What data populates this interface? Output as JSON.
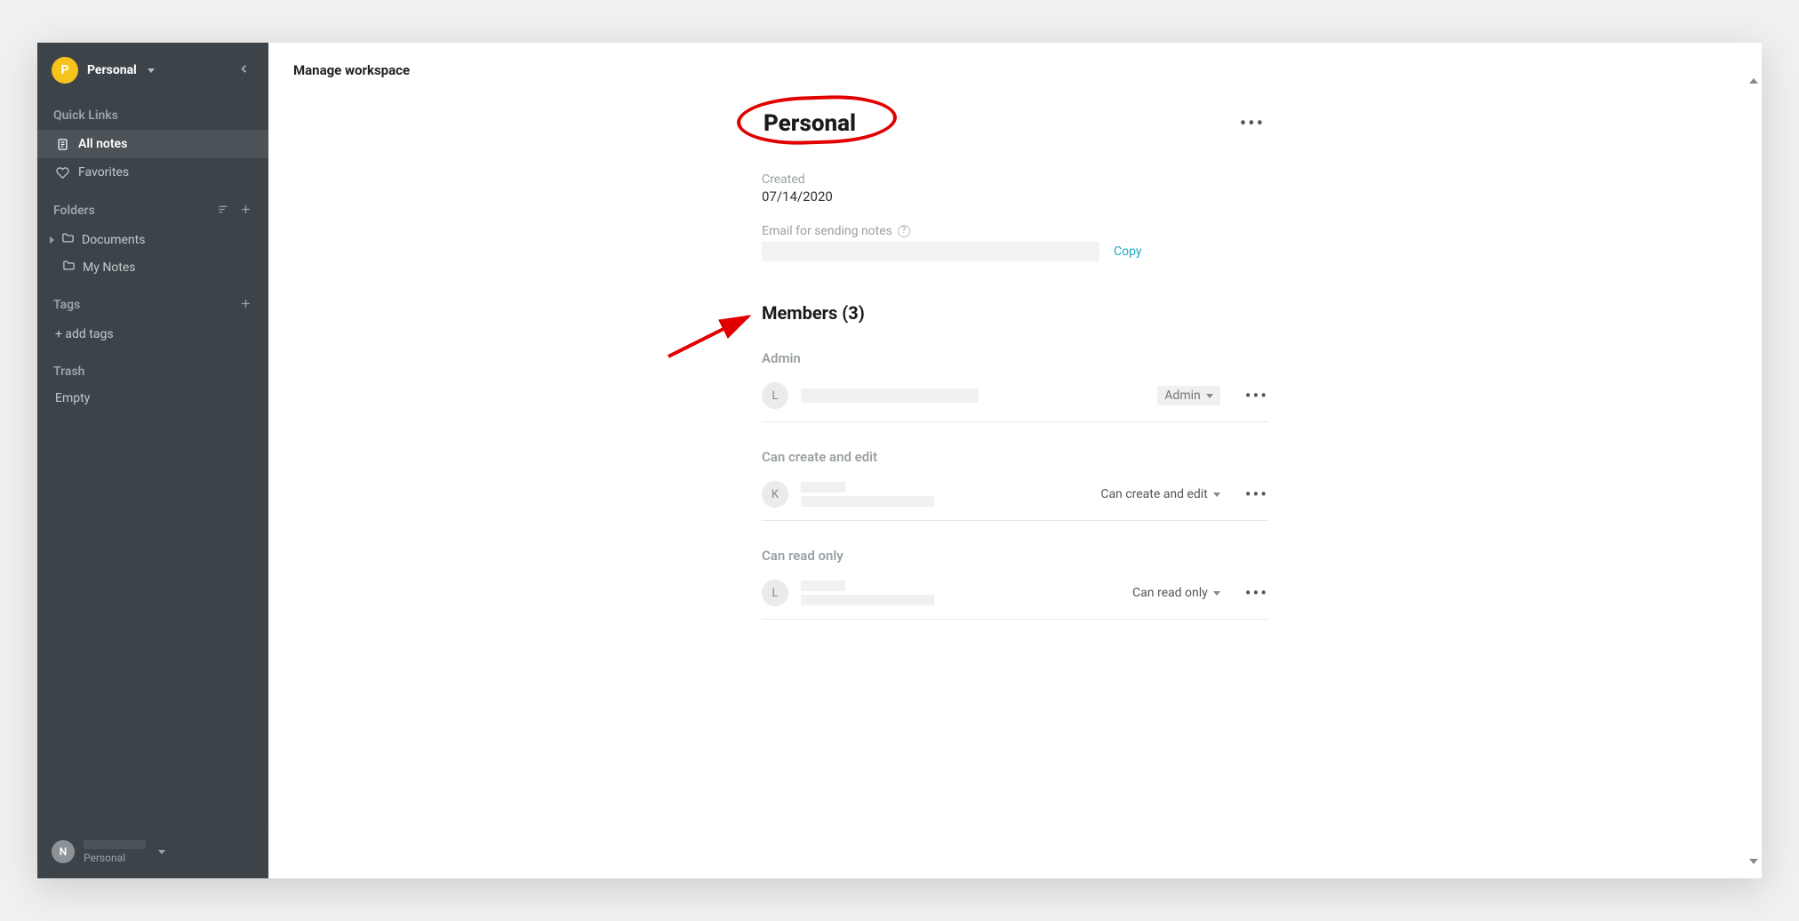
{
  "sidebar": {
    "workspace_avatar_letter": "P",
    "workspace_name": "Personal",
    "quick_links_label": "Quick Links",
    "all_notes": "All notes",
    "favorites": "Favorites",
    "folders_label": "Folders",
    "folders": {
      "documents": "Documents",
      "my_notes": "My Notes"
    },
    "tags_label": "Tags",
    "add_tags": "+ add tags",
    "trash_label": "Trash",
    "trash_empty": "Empty",
    "footer_user_avatar": "N",
    "footer_sub": "Personal"
  },
  "main": {
    "header": "Manage workspace",
    "title": "Personal",
    "created_label": "Created",
    "created_value": "07/14/2020",
    "email_label": "Email for sending notes",
    "copy": "Copy",
    "members_heading": "Members (3)",
    "groups": {
      "admin_label": "Admin",
      "editor_label": "Can create and edit",
      "reader_label": "Can read only"
    },
    "members": {
      "admin": {
        "avatar": "L",
        "role": "Admin"
      },
      "editor": {
        "avatar": "K",
        "role": "Can create and edit"
      },
      "reader": {
        "avatar": "L",
        "role": "Can read only"
      }
    }
  }
}
